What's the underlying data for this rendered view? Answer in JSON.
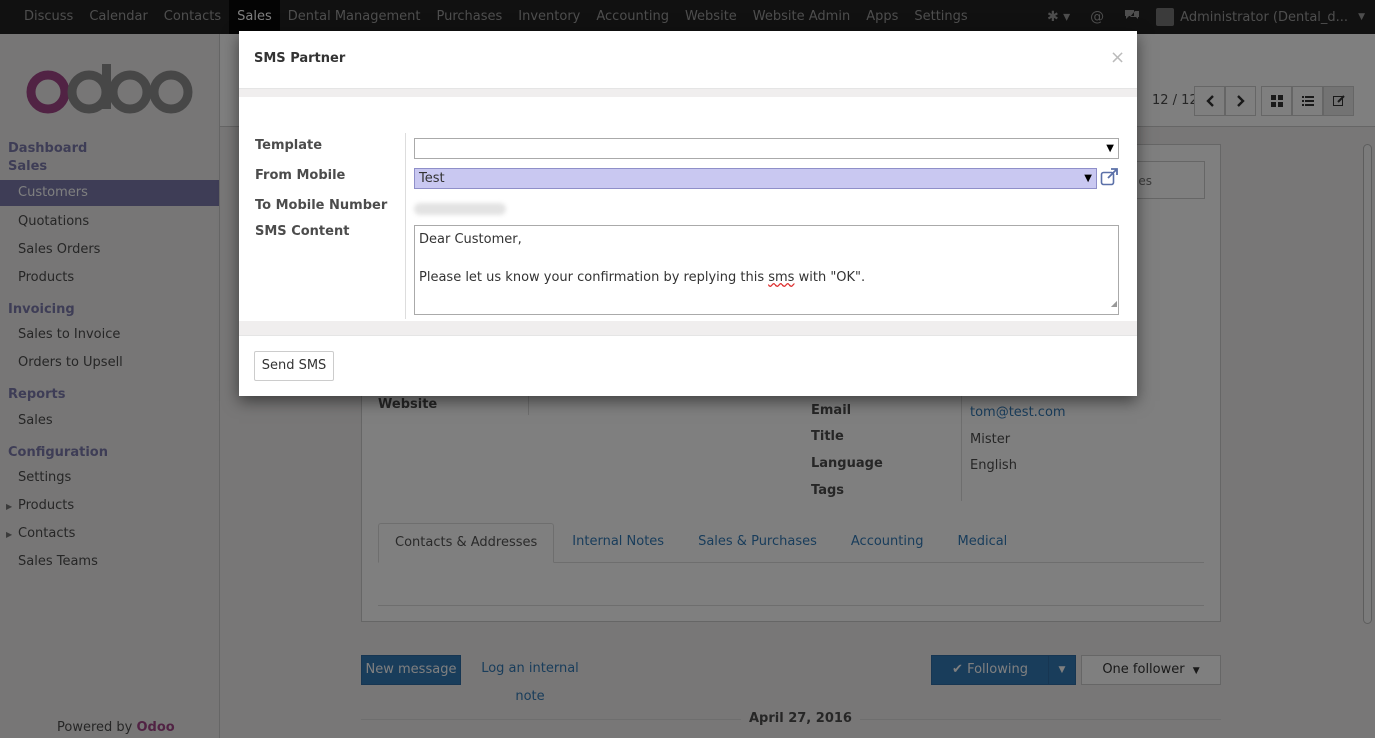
{
  "topbar": {
    "menus": [
      "Discuss",
      "Calendar",
      "Contacts",
      "Sales",
      "Dental Management",
      "Purchases",
      "Inventory",
      "Accounting",
      "Website",
      "Website Admin",
      "Apps",
      "Settings"
    ],
    "active_menu": "Sales",
    "user": "Administrator (Dental_d..."
  },
  "sidebar": {
    "dashboard": "Dashboard",
    "sales_head": "Sales",
    "sales_items": [
      "Customers",
      "Quotations",
      "Sales Orders",
      "Products"
    ],
    "invoicing_head": "Invoicing",
    "invoicing_items": [
      "Sales to Invoice",
      "Orders to Upsell"
    ],
    "reports_head": "Reports",
    "reports_items": [
      "Sales"
    ],
    "config_head": "Configuration",
    "config_items": [
      "Settings",
      "Products",
      "Contacts",
      "Sales Teams"
    ],
    "powered_by": "Powered by",
    "powered_brand": "Odoo"
  },
  "control_panel": {
    "pager": "12 / 12"
  },
  "form": {
    "ghost_button": "es",
    "website_label": "Website",
    "email_label": "Email",
    "email_value": "tom@test.com",
    "title_label": "Title",
    "title_value": "Mister",
    "language_label": "Language",
    "language_value": "English",
    "tags_label": "Tags",
    "tabs": [
      "Contacts & Addresses",
      "Internal Notes",
      "Sales & Purchases",
      "Accounting",
      "Medical"
    ]
  },
  "chatter": {
    "new_message": "New message",
    "log_note": "Log an internal note",
    "following": "Following",
    "followers": "One follower",
    "date": "April 27, 2016"
  },
  "dialog": {
    "title": "SMS Partner",
    "close": "×",
    "template_label": "Template",
    "template_value": "",
    "from_label": "From Mobile",
    "from_value": "Test",
    "to_label": "To Mobile Number",
    "content_label": "SMS Content",
    "content_line1": "Dear Customer,",
    "content_line2_before": "Please let us know your confirmation by replying this ",
    "content_line2_word": "sms",
    "content_line2_after": " with \"OK\".",
    "send_button": "Send SMS"
  },
  "colors": {
    "brand": "#7c7bad",
    "link": "#337ab7",
    "odoo": "#a24689"
  }
}
